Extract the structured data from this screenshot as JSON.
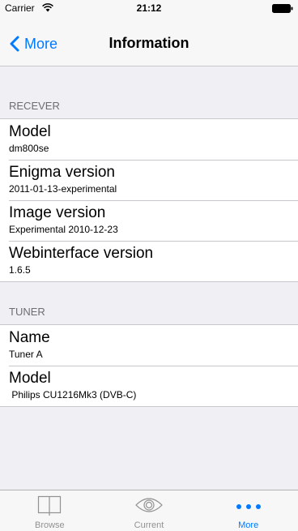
{
  "status_bar": {
    "carrier": "Carrier",
    "time": "21:12"
  },
  "nav": {
    "back_label": "More",
    "title": "Information"
  },
  "sections": {
    "receiver": {
      "header": "RECEVER",
      "rows": [
        {
          "title": "Model",
          "value": "dm800se"
        },
        {
          "title": "Enigma version",
          "value": "2011-01-13-experimental"
        },
        {
          "title": "Image version",
          "value": "Experimental 2010-12-23"
        },
        {
          "title": "Webinterface version",
          "value": "1.6.5"
        }
      ]
    },
    "tuner": {
      "header": "TUNER",
      "rows": [
        {
          "title": "Name",
          "value": "Tuner A"
        },
        {
          "title": "Model",
          "value": " Philips CU1216Mk3 (DVB-C)"
        }
      ]
    }
  },
  "tab_bar": {
    "tabs": [
      {
        "label": "Browse",
        "icon": "book-icon"
      },
      {
        "label": "Current",
        "icon": "eye-icon"
      },
      {
        "label": "More",
        "icon": "more-icon"
      }
    ],
    "active_tab": "More"
  },
  "colors": {
    "accent": "#007aff",
    "background": "#efeff4",
    "tab_inactive": "#929292"
  }
}
